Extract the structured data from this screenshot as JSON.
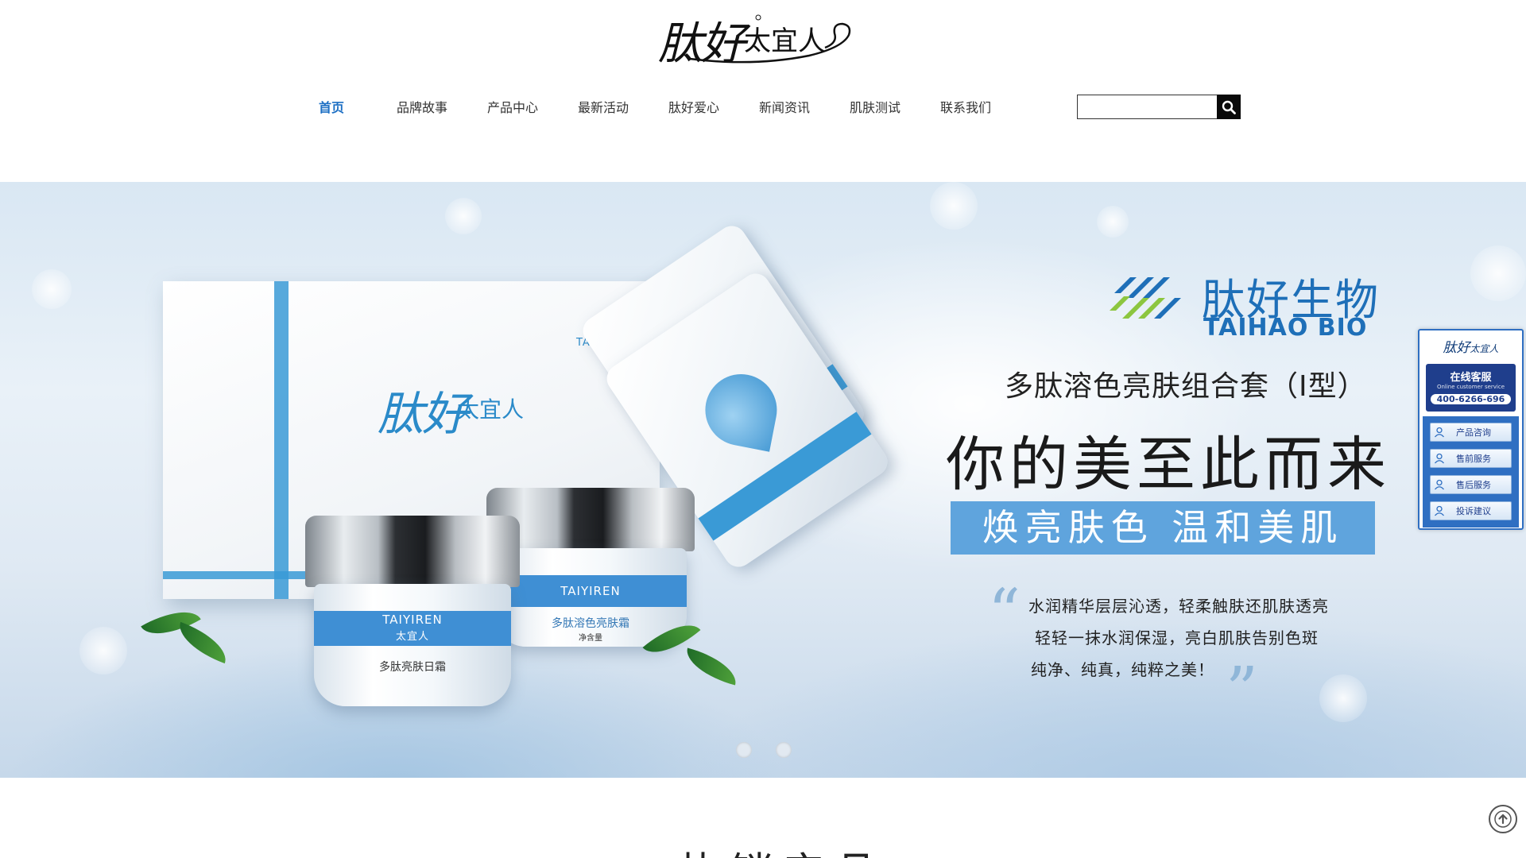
{
  "header": {
    "logo": {
      "main": "肽好",
      "sub": "太宜人"
    }
  },
  "nav": {
    "items": [
      {
        "label": "首页",
        "active": true
      },
      {
        "label": "品牌故事",
        "active": false
      },
      {
        "label": "产品中心",
        "active": false
      },
      {
        "label": "最新活动",
        "active": false
      },
      {
        "label": "肽好爱心",
        "active": false
      },
      {
        "label": "新闻资讯",
        "active": false
      },
      {
        "label": "肌肤测试",
        "active": false
      },
      {
        "label": "联系我们",
        "active": false
      }
    ]
  },
  "search": {
    "value": "",
    "placeholder": "",
    "icon": "search-icon"
  },
  "banner": {
    "bio_brand_cn": "肽好生物",
    "bio_brand_en": "TAIHAO BIO",
    "set_name": "多肽溶色亮肤组合套（I型）",
    "headline": "你的美至此而来",
    "ribbon": "焕亮肤色 温和美肌",
    "copy": [
      "水润精华层层沁透，轻柔触肤还肌肤透亮",
      "轻轻一抹水润保湿，亮白肌肤告别色斑",
      "纯净、纯真，纯粹之美！"
    ],
    "quote_open": "“",
    "quote_close": "”",
    "product": {
      "box_brand": "肽好",
      "box_brand_sub": "太宜人",
      "box_tag": "TAIYIREN",
      "sachet_tag": "TAIYIREN",
      "jar1_brand": "TAIYIREN",
      "jar1_sub": "太宜人",
      "jar1_name": "多肽亮肤日霜",
      "jar2_brand": "TAIYIREN",
      "jar2_name": "多肽溶色亮肤霜",
      "jar2_net": "净含量"
    },
    "slides": 2,
    "accent": "#5fa4dd"
  },
  "service": {
    "logo_main": "肽好",
    "logo_sub": "太宜人",
    "title": "在线客服",
    "subtitle": "Online customer service",
    "hotline": "400-6266-696",
    "links": [
      "产品咨询",
      "售前服务",
      "售后服务",
      "投诉建议"
    ]
  },
  "section": {
    "title": "热销产品"
  },
  "colors": {
    "nav_active": "#1c6fc4",
    "brand_blue": "#1e6fb8",
    "panel_blue": "#2f6fc2"
  }
}
